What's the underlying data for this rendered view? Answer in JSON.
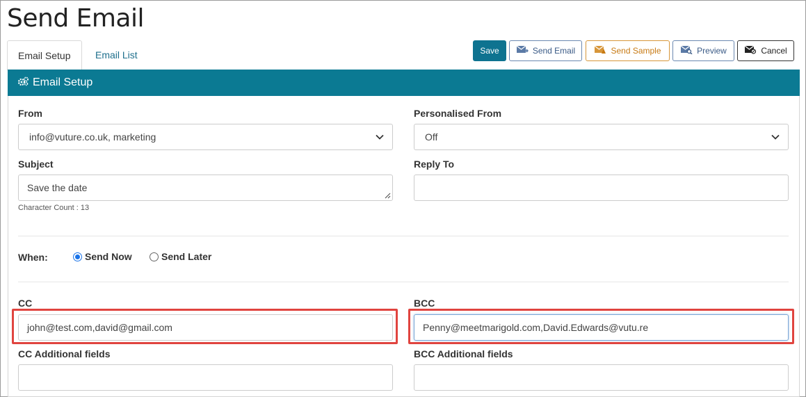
{
  "page": {
    "title": "Send Email"
  },
  "tabs": [
    {
      "label": "Email Setup",
      "active": true
    },
    {
      "label": "Email List",
      "active": false
    }
  ],
  "toolbar": {
    "save": "Save",
    "send_email": "Send Email",
    "send_sample": "Send Sample",
    "preview": "Preview",
    "cancel": "Cancel"
  },
  "panel": {
    "title": "Email Setup",
    "icon": "gears-icon",
    "color": "#0b7a93"
  },
  "form": {
    "from": {
      "label": "From",
      "value": "info@vuture.co.uk, marketing"
    },
    "personalised_from": {
      "label": "Personalised From",
      "value": "Off"
    },
    "subject": {
      "label": "Subject",
      "value": "Save the date",
      "char_count": "Character Count : 13"
    },
    "reply_to": {
      "label": "Reply To",
      "value": ""
    },
    "when": {
      "label": "When:",
      "options": [
        {
          "label": "Send Now",
          "selected": true
        },
        {
          "label": "Send Later",
          "selected": false
        }
      ]
    },
    "cc": {
      "label": "CC",
      "value": "john@test.com,david@gmail.com"
    },
    "bcc": {
      "label": "BCC",
      "value": "Penny@meetmarigold.com,David.Edwards@vutu.re"
    },
    "cc_additional": {
      "label": "CC Additional fields",
      "value": ""
    },
    "bcc_additional": {
      "label": "BCC Additional fields",
      "value": ""
    }
  },
  "colors": {
    "primary": "#0e7390",
    "sample_orange": "#c77a14",
    "link_blue": "#1e6f8c",
    "highlight_red": "#e0443f"
  }
}
